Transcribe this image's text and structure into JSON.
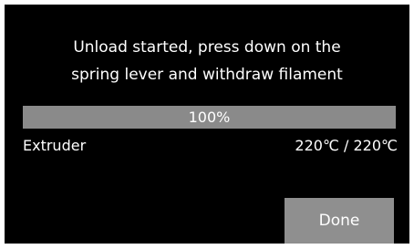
{
  "message": {
    "line1": "Unload started, press down on the",
    "line2": "spring lever and withdraw filament"
  },
  "progress": {
    "percent": 100,
    "label": "100%"
  },
  "extruder": {
    "label": "Extruder",
    "temperature": "220℃ / 220℃"
  },
  "buttons": {
    "done_label": "Done"
  },
  "colors": {
    "background": "#000000",
    "progress_track": "#4a4a4a",
    "progress_fill": "#8a8a8a",
    "button": "#8f8f8f",
    "text": "#ffffff"
  }
}
